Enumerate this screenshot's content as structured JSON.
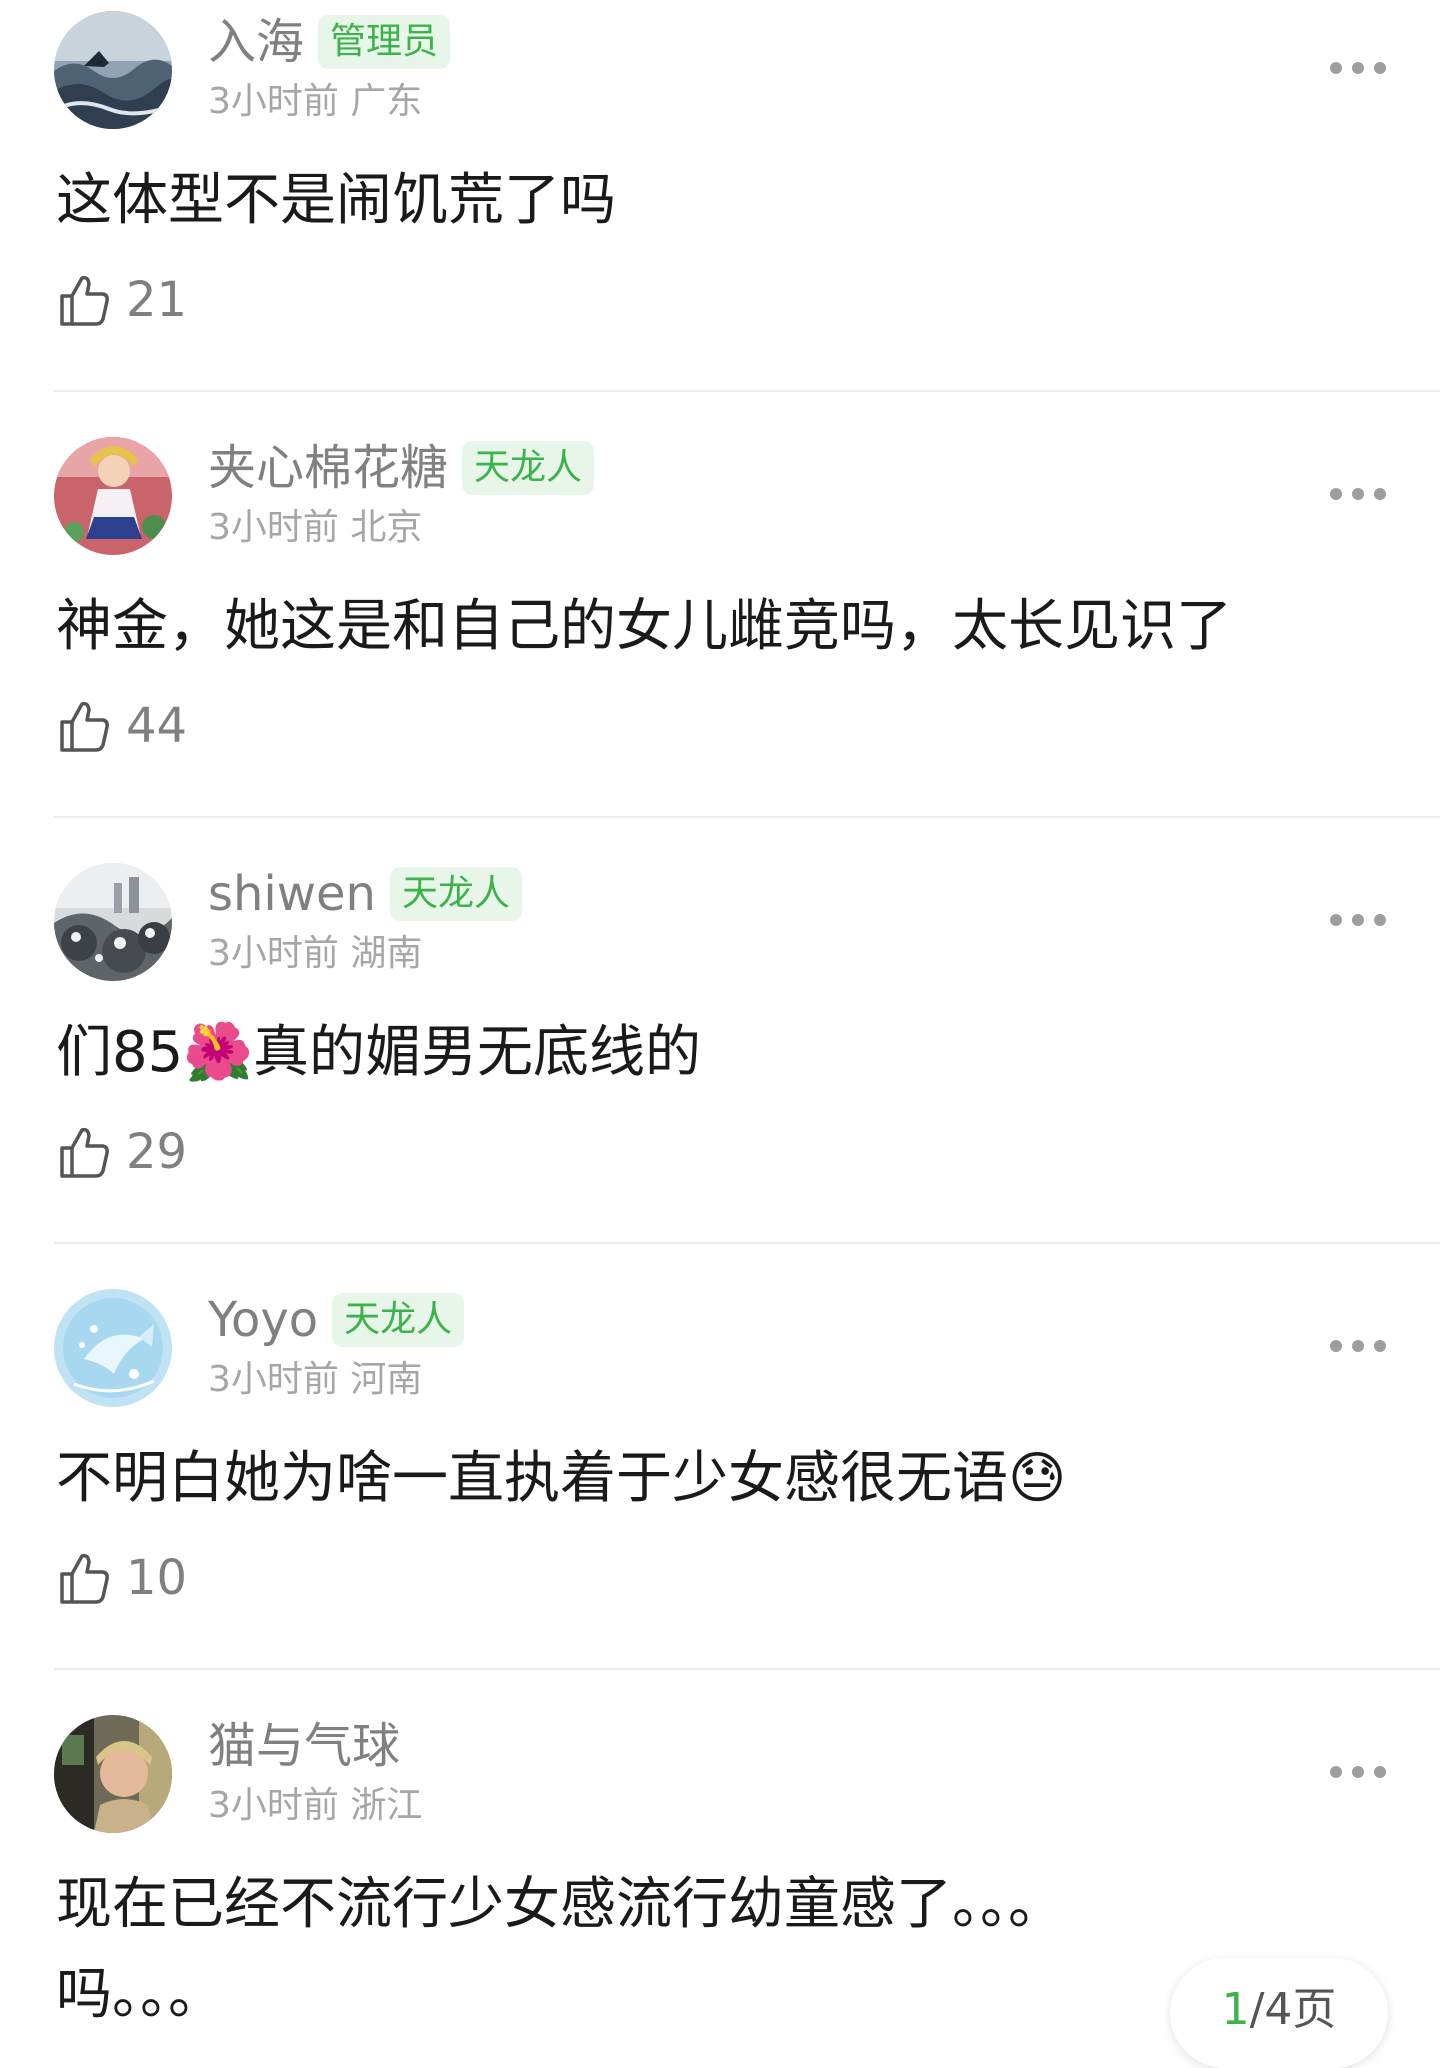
{
  "comments": [
    {
      "username": "入海",
      "badge": "管理员",
      "time_location": "3小时前 广东",
      "content": "这体型不是闹饥荒了吗",
      "likes": "21",
      "avatar_icon": "avatar-ocean-waves-icon"
    },
    {
      "username": "夹心棉花糖",
      "badge": "天龙人",
      "time_location": "3小时前 北京",
      "content": "神金，她这是和自己的女儿雌竞吗，太长见识了",
      "likes": "44",
      "avatar_icon": "avatar-anime-girl-icon"
    },
    {
      "username": "shiwen",
      "badge": "天龙人",
      "time_location": "3小时前 湖南",
      "content": "们85🌺真的媚男无底线的",
      "likes": "29",
      "avatar_icon": "avatar-snowy-trees-icon"
    },
    {
      "username": "Yoyo",
      "badge": "天龙人",
      "time_location": "3小时前 河南",
      "content": "不明白她为啥一直执着于少女感很无语😓",
      "likes": "10",
      "avatar_icon": "avatar-blue-fish-icon"
    },
    {
      "username": "猫与气球",
      "badge": "",
      "time_location": "3小时前 浙江",
      "content": "现在已经不流行少女感流行幼童感了。。。\n吗。。。",
      "likes": "",
      "avatar_icon": "avatar-person-photo-icon"
    }
  ],
  "pagination": {
    "current": "1",
    "total": "/4页"
  },
  "colors": {
    "badge_text": "#3cb34a",
    "badge_bg": "#e8f6ea",
    "username": "#808080",
    "meta": "#a6a6a6"
  }
}
